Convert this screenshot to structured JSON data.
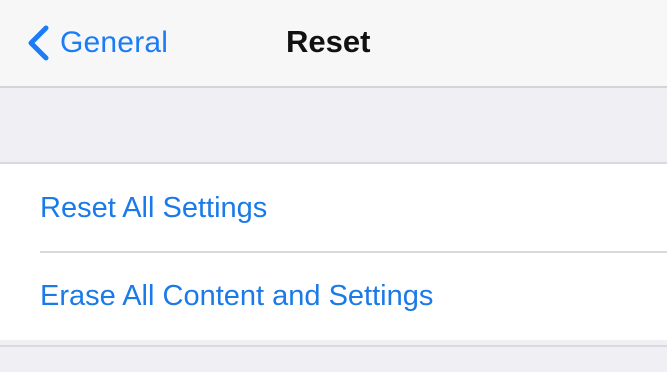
{
  "nav": {
    "back_label": "General",
    "back_icon": "chevron-left-icon",
    "title": "Reset"
  },
  "reset_list": {
    "items": [
      {
        "label": "Reset All Settings"
      },
      {
        "label": "Erase All Content and Settings"
      }
    ]
  },
  "colors": {
    "accent": "#1a7ae8",
    "background": "#efeff4",
    "nav_background": "#f7f7f7",
    "cell_background": "#ffffff",
    "title": "#111111"
  }
}
